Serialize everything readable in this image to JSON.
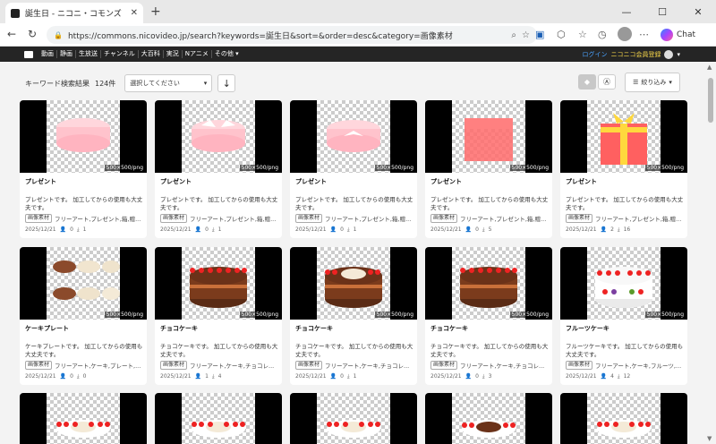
{
  "browser": {
    "tab_title": "誕生日 - ニコニ・コモンズ",
    "url": "https://commons.nicovideo.jp/search?keywords=誕生日&sort=&order=desc&category=画像素材",
    "copilot_label": "Chat"
  },
  "site_nav": {
    "items": [
      "動画",
      "静画",
      "生放送",
      "チャンネル",
      "大百科",
      "実況",
      "Nアニメ",
      "その他 ▾"
    ],
    "login": "ログイン",
    "register": "ニコニコ会員登録"
  },
  "search": {
    "result_label": "キーワード検索結果",
    "result_count": "124件",
    "sort_placeholder": "選択してください",
    "filter_label": "絞り込み"
  },
  "cards": [
    {
      "title": "プレゼント",
      "dims": "500×500/png",
      "desc": "プレゼントです。 加工してからの使用も大丈夫です。",
      "tag": "画像素材",
      "tags": "フリーアート,プレゼント,箱,贈...",
      "date": "2025/12/21",
      "views": "0",
      "dl": "1",
      "art": "box-pink-round"
    },
    {
      "title": "プレゼント",
      "dims": "500×500/png",
      "desc": "プレゼントです。 加工してからの使用も大丈夫です。",
      "tag": "画像素材",
      "tags": "フリーアート,プレゼント,箱,贈...",
      "date": "2025/12/21",
      "views": "0",
      "dl": "1",
      "art": "box-pink-round-open"
    },
    {
      "title": "プレゼント",
      "dims": "500×500/png",
      "desc": "プレゼントです。 加工してからの使用も大丈夫です。",
      "tag": "画像素材",
      "tags": "フリーアート,プレゼント,箱,贈...",
      "date": "2025/12/21",
      "views": "0",
      "dl": "1",
      "art": "box-pink-round-bow"
    },
    {
      "title": "プレゼント",
      "dims": "500×500/png",
      "desc": "プレゼントです。 加工してからの使用も大丈夫です。",
      "tag": "画像素材",
      "tags": "フリーアート,プレゼント,箱,贈...",
      "date": "2025/12/21",
      "views": "0",
      "dl": "5",
      "art": "box-red-square"
    },
    {
      "title": "プレゼント",
      "dims": "500×500/png",
      "desc": "プレゼントです。 加工してからの使用も大丈夫です。",
      "tag": "画像素材",
      "tags": "フリーアート,プレゼント,箱,贈...",
      "date": "2025/12/21",
      "views": "2",
      "dl": "16",
      "art": "box-red-ribbon"
    },
    {
      "title": "ケーキプレート",
      "dims": "500×500/png",
      "desc": "ケーキプレートです。 加工してからの使用も大丈夫です。",
      "tag": "画像素材",
      "tags": "フリーアート,ケーキ,プレート,...",
      "date": "2025/12/21",
      "views": "0",
      "dl": "0",
      "art": "plates"
    },
    {
      "title": "チョコケーキ",
      "dims": "500×500/png",
      "desc": "チョコケーキです。 加工してからの使用も大丈夫です。",
      "tag": "画像素材",
      "tags": "フリーアート,ケーキ,チョコレ...",
      "date": "2025/12/21",
      "views": "1",
      "dl": "4",
      "art": "choco"
    },
    {
      "title": "チョコケーキ",
      "dims": "500×500/png",
      "desc": "チョコケーキです。 加工してからの使用も大丈夫です。",
      "tag": "画像素材",
      "tags": "フリーアート,ケーキ,チョコレ...",
      "date": "2025/12/21",
      "views": "0",
      "dl": "1",
      "art": "choco-plate"
    },
    {
      "title": "チョコケーキ",
      "dims": "500×500/png",
      "desc": "チョコケーキです。 加工してからの使用も大丈夫です。",
      "tag": "画像素材",
      "tags": "フリーアート,ケーキ,チョコレ...",
      "date": "2025/12/21",
      "views": "0",
      "dl": "3",
      "art": "choco"
    },
    {
      "title": "フルーツケーキ",
      "dims": "500×500/png",
      "desc": "フルーツケーキです。 加工してからの使用も大丈夫です。",
      "tag": "画像素材",
      "tags": "フリーアート,ケーキ,フルーツ,...",
      "date": "2025/12/21",
      "views": "4",
      "dl": "12",
      "art": "fruit"
    },
    {
      "art": "white-cake"
    },
    {
      "art": "white-cake"
    },
    {
      "art": "white-cake"
    },
    {
      "art": "white-cake-choco"
    },
    {
      "art": "white-cake"
    }
  ]
}
